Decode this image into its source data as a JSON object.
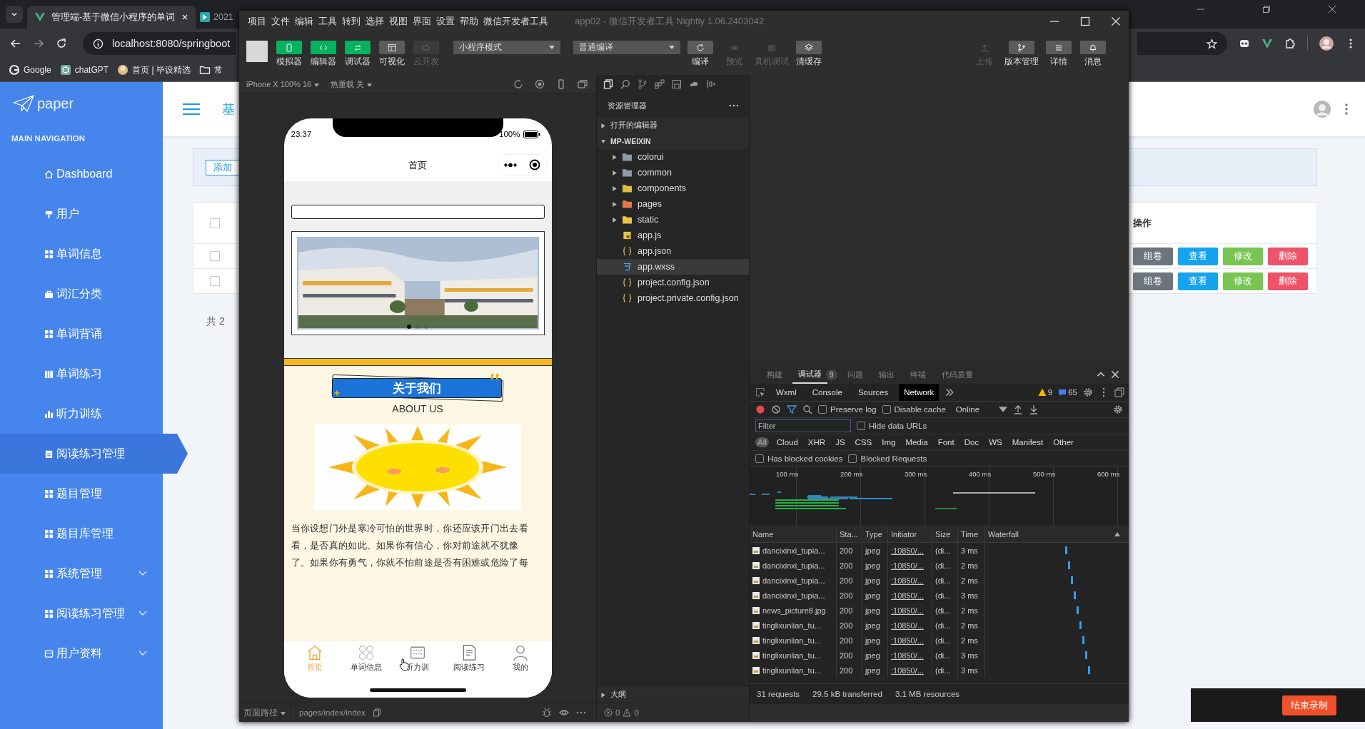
{
  "browser": {
    "tabs": [
      {
        "title": "管理端-基于微信小程序的单词",
        "selected": true
      },
      {
        "title": "2021",
        "selected": false
      }
    ],
    "address": "localhost:8080/springboot",
    "bookmarks": [
      "Google",
      "chatGPT",
      "首页 | 毕设精选",
      "常"
    ]
  },
  "admin": {
    "logo": "paper",
    "nav_heading": "MAIN NAVIGATION",
    "nav": [
      {
        "label": "Dashboard",
        "selected": false,
        "submenu": false
      },
      {
        "label": "用户",
        "selected": false,
        "submenu": false
      },
      {
        "label": "单词信息",
        "selected": false,
        "submenu": false
      },
      {
        "label": "词汇分类",
        "selected": false,
        "submenu": false
      },
      {
        "label": "单词背诵",
        "selected": false,
        "submenu": false
      },
      {
        "label": "单词练习",
        "selected": false,
        "submenu": false
      },
      {
        "label": "听力训练",
        "selected": false,
        "submenu": false
      },
      {
        "label": "阅读练习管理",
        "selected": true,
        "submenu": false
      },
      {
        "label": "题目管理",
        "selected": false,
        "submenu": false
      },
      {
        "label": "题目库管理",
        "selected": false,
        "submenu": false
      },
      {
        "label": "系统管理",
        "selected": false,
        "submenu": true
      },
      {
        "label": "阅读练习管理",
        "selected": false,
        "submenu": true
      },
      {
        "label": "用户资料",
        "selected": false,
        "submenu": true
      }
    ],
    "header_title": "基",
    "add_button": "添加",
    "table": {
      "select_all_checked": false,
      "actions_header": "操作",
      "rows": [
        {
          "checked": false,
          "actions": [
            "组卷",
            "查看",
            "修改",
            "删除"
          ]
        },
        {
          "checked": false,
          "actions": [
            "组卷",
            "查看",
            "修改",
            "删除"
          ]
        }
      ]
    },
    "total": "共 2"
  },
  "devtools": {
    "menu": [
      "项目",
      "文件",
      "编辑",
      "工具",
      "转到",
      "选择",
      "视图",
      "界面",
      "设置",
      "帮助",
      "微信开发者工具"
    ],
    "title": "app02 - 微信开发者工具 Nightly 1.06.2403042",
    "left_tools": [
      {
        "label": "模拟器",
        "on": true,
        "disabled": false
      },
      {
        "label": "编辑器",
        "on": true,
        "disabled": false
      },
      {
        "label": "调试器",
        "on": true,
        "disabled": false
      },
      {
        "label": "可视化",
        "on": false,
        "disabled": false
      },
      {
        "label": "云开发",
        "on": false,
        "disabled": true
      }
    ],
    "mode_select": "小程序模式",
    "compile_select": "普通编译",
    "compile_tools": [
      {
        "label": "编译",
        "disabled": false
      },
      {
        "label": "预览",
        "disabled": true
      },
      {
        "label": "真机调试",
        "disabled": true
      },
      {
        "label": "清缓存",
        "disabled": false
      }
    ],
    "right_tools": [
      {
        "label": "上传",
        "disabled": true
      },
      {
        "label": "版本管理",
        "disabled": false
      },
      {
        "label": "详情",
        "disabled": false
      },
      {
        "label": "消息",
        "disabled": false
      }
    ]
  },
  "simulator": {
    "device": "iPhone X 100% 16",
    "hot_reload": "热重载 关",
    "time": "23:37",
    "battery": "100%",
    "page_title": "首页",
    "about_title": "关于我们",
    "about_subtitle": "ABOUT US",
    "paragraph": "当你设想门外是寒冷可怕的世界时，你还应该开门出去看看，是否真的如此。如果你有信心，你对前途就不犹豫了。如果你有勇气，你就不怕前途是否有困难或危险了每",
    "tabbar": [
      {
        "label": "首页",
        "selected": true
      },
      {
        "label": "单词信息",
        "selected": false
      },
      {
        "label": "听力训",
        "selected": false
      },
      {
        "label": "阅读练习",
        "selected": false
      },
      {
        "label": "我的",
        "selected": false
      }
    ],
    "page_path_label": "页面路径",
    "page_path": "pages/index/index"
  },
  "explorer": {
    "title": "资源管理器",
    "open_editors": "打开的编辑器",
    "project": "MP-WEIXIN",
    "files": [
      {
        "name": "colorui",
        "kind": "folder",
        "selected": false
      },
      {
        "name": "common",
        "kind": "folder",
        "selected": false
      },
      {
        "name": "components",
        "kind": "folder",
        "selected": false
      },
      {
        "name": "pages",
        "kind": "folder",
        "selected": false
      },
      {
        "name": "static",
        "kind": "folder",
        "selected": false
      },
      {
        "name": "app.js",
        "kind": "js",
        "selected": false
      },
      {
        "name": "app.json",
        "kind": "json",
        "selected": false
      },
      {
        "name": "app.wxss",
        "kind": "wxss",
        "selected": true
      },
      {
        "name": "project.config.json",
        "kind": "json",
        "selected": false
      },
      {
        "name": "project.private.config.json",
        "kind": "json",
        "selected": false
      }
    ],
    "outline": "大纲",
    "errors": "0",
    "warnings": "0"
  },
  "debugger": {
    "panel_tabs": [
      {
        "label": "构建",
        "selected": false
      },
      {
        "label": "调试器",
        "selected": true,
        "badge": "9"
      },
      {
        "label": "问题",
        "selected": false
      },
      {
        "label": "输出",
        "selected": false
      },
      {
        "label": "终端",
        "selected": false
      },
      {
        "label": "代码质量",
        "selected": false
      }
    ],
    "tool_tabs": [
      {
        "label": "Wxml",
        "selected": false
      },
      {
        "label": "Console",
        "selected": false
      },
      {
        "label": "Sources",
        "selected": false
      },
      {
        "label": "Network",
        "selected": true
      }
    ],
    "warnings": "9",
    "messages": "65",
    "preserve_log": {
      "label": "Preserve log",
      "checked": false
    },
    "disable_cache": {
      "label": "Disable cache",
      "checked": false
    },
    "throttle": "Online",
    "filter_placeholder": "Filter",
    "hide_data_urls": {
      "label": "Hide data URLs",
      "checked": false
    },
    "types": [
      {
        "label": "All",
        "selected": true
      },
      {
        "label": "Cloud",
        "selected": false
      },
      {
        "label": "XHR",
        "selected": false
      },
      {
        "label": "JS",
        "selected": false
      },
      {
        "label": "CSS",
        "selected": false
      },
      {
        "label": "Img",
        "selected": false
      },
      {
        "label": "Media",
        "selected": false
      },
      {
        "label": "Font",
        "selected": false
      },
      {
        "label": "Doc",
        "selected": false
      },
      {
        "label": "WS",
        "selected": false
      },
      {
        "label": "Manifest",
        "selected": false
      },
      {
        "label": "Other",
        "selected": false
      }
    ],
    "blocked": [
      {
        "label": "Has blocked cookies",
        "checked": false
      },
      {
        "label": "Blocked Requests",
        "checked": false
      }
    ],
    "overview_ticks": [
      "100 ms",
      "200 ms",
      "300 ms",
      "400 ms",
      "500 ms",
      "600 ms"
    ],
    "columns": [
      "Name",
      "Sta...",
      "Type",
      "Initiator",
      "Size",
      "Time",
      "Waterfall"
    ],
    "requests": [
      {
        "name": "dancixinxi_tupia...",
        "status": "200",
        "type": "jpeg",
        "initiator": ":10850/...",
        "size": "(di...",
        "time": "3 ms"
      },
      {
        "name": "dancixinxi_tupia...",
        "status": "200",
        "type": "jpeg",
        "initiator": ":10850/...",
        "size": "(di...",
        "time": "2 ms"
      },
      {
        "name": "dancixinxi_tupia...",
        "status": "200",
        "type": "jpeg",
        "initiator": ":10850/...",
        "size": "(di...",
        "time": "2 ms"
      },
      {
        "name": "dancixinxi_tupia...",
        "status": "200",
        "type": "jpeg",
        "initiator": ":10850/...",
        "size": "(di...",
        "time": "3 ms"
      },
      {
        "name": "news_picture8.jpg",
        "status": "200",
        "type": "jpeg",
        "initiator": ":10850/...",
        "size": "(di...",
        "time": "2 ms"
      },
      {
        "name": "tinglixunlian_tu...",
        "status": "200",
        "type": "jpeg",
        "initiator": ":10850/...",
        "size": "(di...",
        "time": "2 ms"
      },
      {
        "name": "tinglixunlian_tu...",
        "status": "200",
        "type": "jpeg",
        "initiator": ":10850/...",
        "size": "(di...",
        "time": "2 ms"
      },
      {
        "name": "tinglixunlian_tu...",
        "status": "200",
        "type": "jpeg",
        "initiator": ":10850/...",
        "size": "(di...",
        "time": "3 ms"
      },
      {
        "name": "tinglixunlian_tu...",
        "status": "200",
        "type": "jpeg",
        "initiator": ":10850/...",
        "size": "(di...",
        "time": "3 ms"
      }
    ],
    "summary": [
      "31 requests",
      "29.5 kB transferred",
      "3.1 MB resources"
    ]
  },
  "recorder": {
    "stop_label": "结束录制"
  }
}
